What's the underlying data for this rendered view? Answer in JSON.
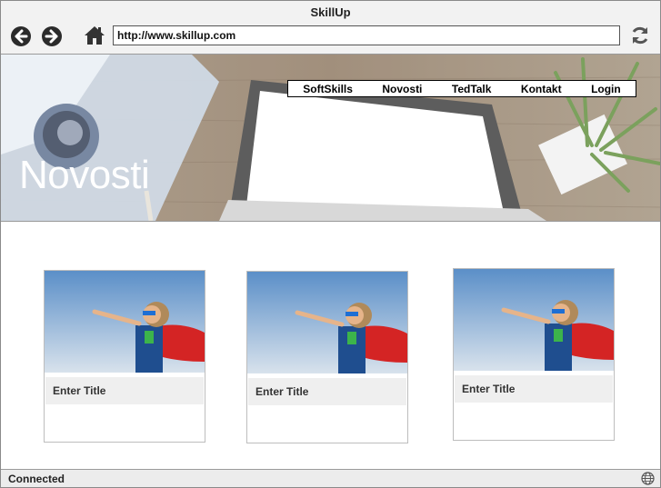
{
  "window": {
    "title": "SkillUp"
  },
  "toolbar": {
    "url": "http://www.skillup.com",
    "back_icon": "arrow-left-icon",
    "forward_icon": "arrow-right-icon",
    "home_icon": "home-icon",
    "reload_icon": "reload-icon"
  },
  "nav": {
    "items": [
      {
        "label": "SoftSkills"
      },
      {
        "label": "Novosti"
      },
      {
        "label": "TedTalk"
      },
      {
        "label": "Kontakt"
      },
      {
        "label": "Login"
      }
    ]
  },
  "hero": {
    "heading": "Novosti"
  },
  "cards": [
    {
      "title": "Enter Title"
    },
    {
      "title": "Enter Title"
    },
    {
      "title": "Enter Title"
    }
  ],
  "status": {
    "text": "Connected",
    "icon": "globe-icon"
  }
}
